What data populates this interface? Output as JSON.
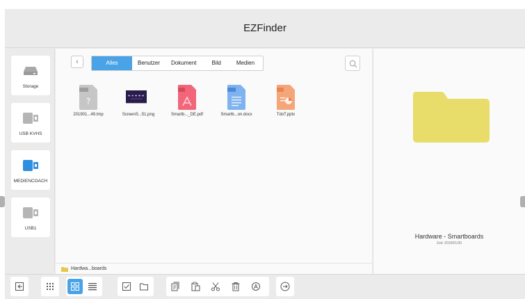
{
  "app": {
    "title": "EZFinder"
  },
  "sidebar": {
    "items": [
      {
        "label": "Storage",
        "icon": "hdd-icon",
        "color": "#a8a8a8",
        "selected": false
      },
      {
        "label": "USB KVHS",
        "icon": "usb-icon",
        "color": "#b5b5b5",
        "selected": false
      },
      {
        "label": "MEDIENCOACH",
        "icon": "usb-icon",
        "color": "#2f8ee0",
        "selected": true
      },
      {
        "label": "USB1",
        "icon": "usb-icon",
        "color": "#b5b5b5",
        "selected": false
      }
    ]
  },
  "filter": {
    "tabs": [
      "Alles",
      "Benutzer",
      "Dokument",
      "Bild",
      "Medien"
    ],
    "active": "Alles",
    "accent": "#4aa3e6"
  },
  "files": [
    {
      "name": "201901...49.tmp",
      "type": "unknown",
      "badge": "Unknown",
      "color": "#bdbdbd"
    },
    {
      "name": "ScreenS...51.png",
      "type": "image",
      "badge": "",
      "color": "#2a1b4a"
    },
    {
      "name": "Smartb..._DE.pdf",
      "type": "pdf",
      "badge": "PDF",
      "color": "#f2667a"
    },
    {
      "name": "Smartb...on.docx",
      "type": "word",
      "badge": "Word",
      "color": "#5b9be8"
    },
    {
      "name": "TdoT.pptx",
      "type": "ppt",
      "badge": "PPT",
      "color": "#f39a6a"
    }
  ],
  "path": {
    "label": "Hardwa...boards"
  },
  "preview": {
    "name": "Hardware - Smartboards",
    "time": "Zeit: 2019/01/30",
    "folder_color": "#e8dc6a"
  },
  "toolbar": {
    "icons": [
      "exit-icon",
      "apps-grid-icon",
      "grid-view-icon",
      "list-view-icon",
      "select-icon",
      "new-folder-icon",
      "copy-icon",
      "paste-icon",
      "cut-icon",
      "delete-icon",
      "rename-icon",
      "more-icon"
    ]
  }
}
